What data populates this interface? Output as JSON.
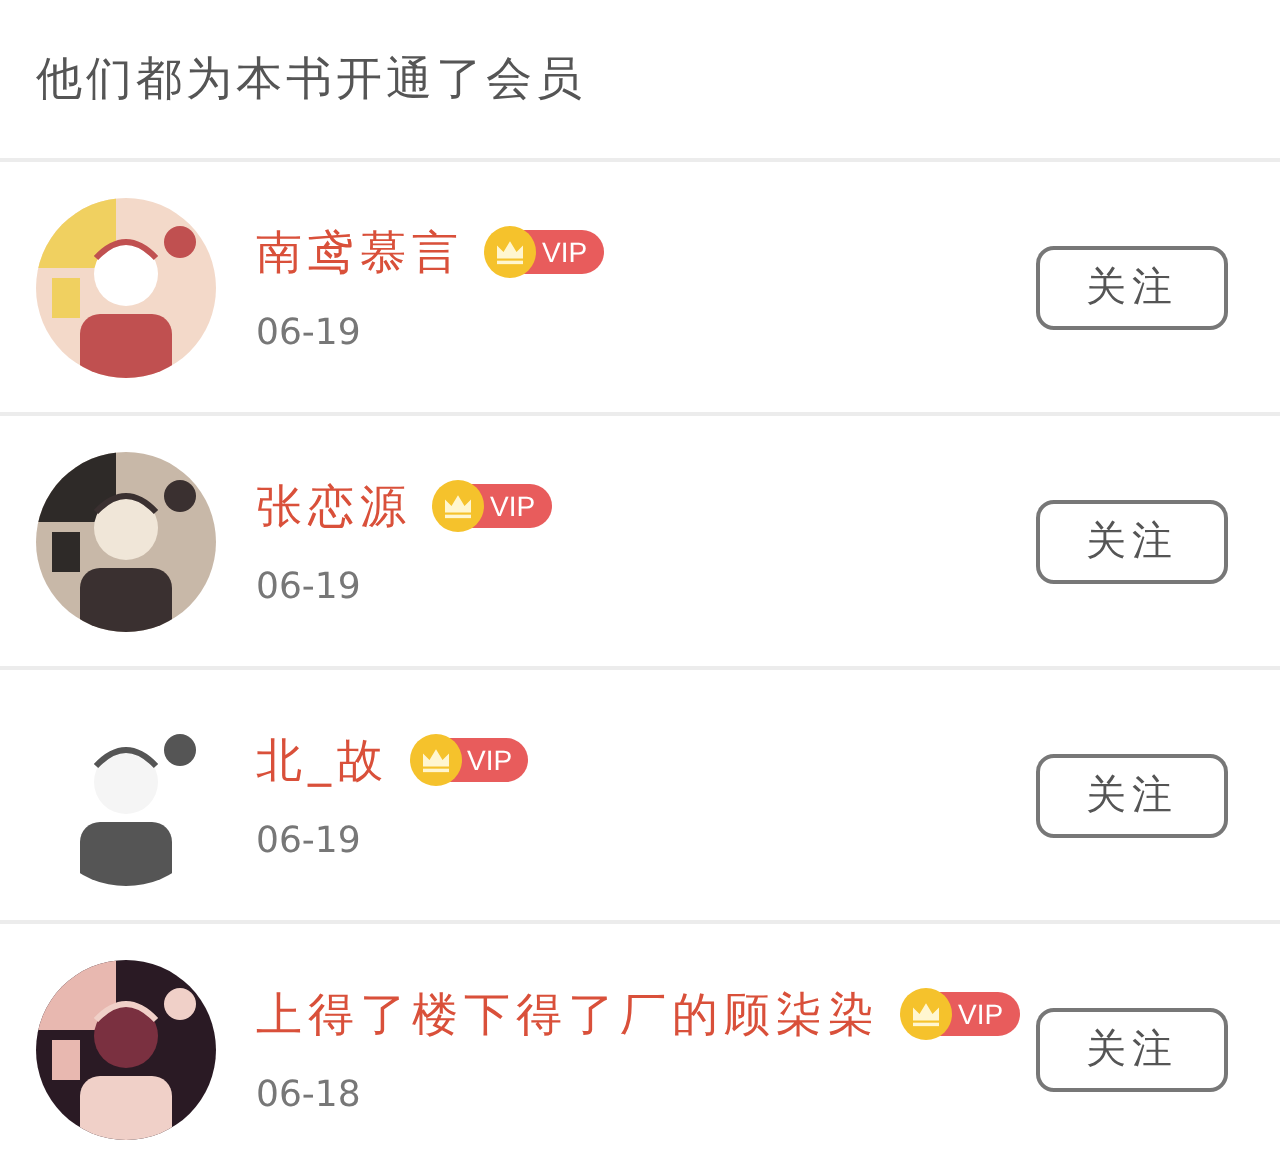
{
  "header": {
    "title": "他们都为本书开通了会员"
  },
  "members": [
    {
      "name": "南鸢慕言",
      "badge": "VIP",
      "date": "06-19",
      "button": "关注"
    },
    {
      "name": "张恋源",
      "badge": "VIP",
      "date": "06-19",
      "button": "关注"
    },
    {
      "name": "北_故",
      "badge": "VIP",
      "date": "06-19",
      "button": "关注"
    },
    {
      "name": "上得了楼下得了厂的顾柒染",
      "badge": "VIP",
      "date": "06-18",
      "button": "关注"
    }
  ]
}
